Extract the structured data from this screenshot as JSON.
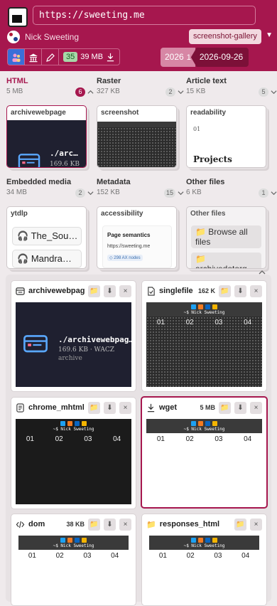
{
  "header": {
    "url": "https://sweeting.me",
    "title": "Nick Sweeting",
    "tag": "screenshot-gallery",
    "total_size": "39 MB",
    "archive_count": "35",
    "date_year": "2026",
    "date_year_count": "1",
    "date_full": "2026-09-26",
    "menu_icon": "caret-down-icon"
  },
  "colors": {
    "brand": "#a6174e",
    "badge_green": "#a7d8a8",
    "selected_border": "#a6174e"
  },
  "sections": [
    {
      "title": "HTML",
      "size": "5 MB",
      "count": "6",
      "active": true,
      "card_label": "archivewebpage",
      "card_file": "./arc…",
      "card_file_size": "169.6 KB"
    },
    {
      "title": "Raster",
      "size": "327 KB",
      "count": "2",
      "card_label": "screenshot"
    },
    {
      "title": "Article text",
      "size": "15 KB",
      "count": "5",
      "card_label": "readability",
      "card_num": "01",
      "card_heading": "Projects"
    },
    {
      "title": "Embedded media",
      "size": "34 MB",
      "count": "2",
      "card_label": "ytdlp",
      "items": [
        "The_Sou…",
        "Mandra…"
      ]
    },
    {
      "title": "Metadata",
      "size": "152 KB",
      "count": "15",
      "card_label": "accessibility",
      "card_heading": "Page semantics",
      "card_url": "https://sweeting.me",
      "card_note": "◇ 298 AX nodes"
    },
    {
      "title": "Other files",
      "size": "6 KB",
      "count": "1",
      "card_label": "Other files",
      "items": [
        "📁 Browse all files",
        "📁 archivedotorg"
      ]
    }
  ],
  "grid": [
    {
      "name": "archivewebpag",
      "icon": "archive-icon",
      "size": "",
      "file": "./archivewebpag…",
      "file_meta": "169.6 KB · WACZ",
      "file_type": "archive"
    },
    {
      "name": "singlefile",
      "icon": "file-check-icon",
      "size": "162 K"
    },
    {
      "name": "chrome_mhtml",
      "icon": "document-icon",
      "size": ""
    },
    {
      "name": "wget",
      "icon": "download-icon",
      "size": "5 MB"
    },
    {
      "name": "dom",
      "icon": "code-icon",
      "size": "38 KB"
    },
    {
      "name": "responses_html",
      "icon": "folder-icon",
      "size": ""
    }
  ],
  "thumb": {
    "nav_text": "~$ Nick Sweeting",
    "numbers": [
      "01",
      "02",
      "03",
      "04"
    ]
  }
}
